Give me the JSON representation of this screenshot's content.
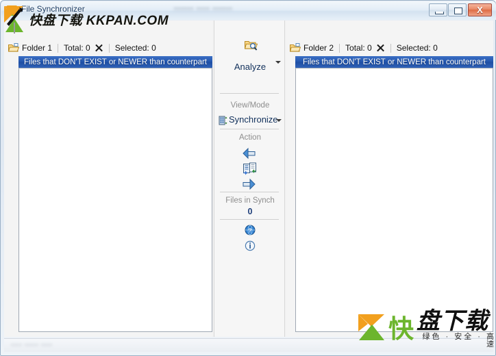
{
  "window": {
    "title": "File Synchronizer",
    "app_icon": "k-logo-icon",
    "title_obscured_text": "••••••  ••••  ••••••",
    "controls": {
      "minimize_label": "–",
      "maximize_label": "❐",
      "close_label": "X"
    }
  },
  "panels": {
    "left": {
      "folder_label": "Folder 1",
      "total_label": "Total: 0",
      "selected_label": "Selected: 0",
      "clear_icon": "x-clear-icon",
      "folder_icon": "open-folder-icon",
      "filter_label": "Files that DON'T EXIST or NEWER than counterpart",
      "items": []
    },
    "right": {
      "folder_label": "Folder 2",
      "total_label": "Total: 0",
      "selected_label": "Selected: 0",
      "clear_icon": "x-clear-icon",
      "folder_icon": "open-folder-icon",
      "filter_label": "Files that DON'T EXIST or NEWER than counterpart",
      "items": []
    }
  },
  "center": {
    "analyze": {
      "label": "Analyze",
      "icon": "folder-search-icon",
      "dropdown_icon": "chevron-down-icon"
    },
    "view_mode": {
      "section_label": "View/Mode",
      "value": "Synchronize",
      "icon": "synchronize-icon",
      "dropdown_icon": "chevron-down-icon"
    },
    "action": {
      "section_label": "Action",
      "copy_left_icon": "arrow-left-icon",
      "sync_icon": "document-sync-icon",
      "copy_right_icon": "arrow-right-icon"
    },
    "files_in_synch": {
      "label": "Files in Synch",
      "value": "0"
    },
    "help_icon": "help-globe-icon",
    "info_icon": "info-icon"
  },
  "status_bar": {
    "obscured_text": "••••  •••••  ••••"
  },
  "watermarks": {
    "top": {
      "logo_icon": "kuaipan-k-logo-icon",
      "text": "快盘下载  KKPAN.COM"
    },
    "bottom": {
      "logo_icon": "kuaipan-k-logo-icon",
      "text_green": "快",
      "text_black": "盘下载",
      "tagline": "绿色 · 安全 · 高速"
    }
  },
  "colors": {
    "filter_bar_blue": "#2255ad",
    "title_text": "#1c3c63",
    "accent_green": "#6cb52d",
    "accent_orange": "#f2a01e",
    "close_red": "#dd6b45"
  }
}
